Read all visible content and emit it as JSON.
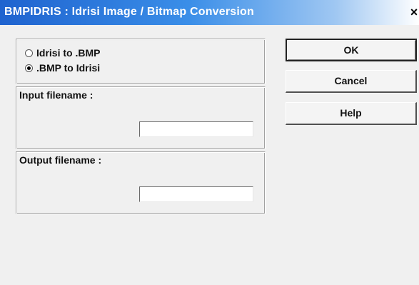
{
  "window": {
    "title": "BMPIDRIS : Idrisi Image / Bitmap Conversion",
    "close_glyph": "×"
  },
  "conversion": {
    "options": [
      {
        "label": "Idrisi to .BMP",
        "selected": false
      },
      {
        "label": ".BMP to Idrisi",
        "selected": true
      }
    ]
  },
  "input_group": {
    "label": "Input filename :",
    "value": ""
  },
  "output_group": {
    "label": "Output filename :",
    "value": ""
  },
  "buttons": {
    "ok": "OK",
    "cancel": "Cancel",
    "help": "Help"
  },
  "colors": {
    "titlebar_start": "#1f63cf",
    "titlebar_end": "#ffffff",
    "dialog_bg": "#f0f0f0"
  }
}
